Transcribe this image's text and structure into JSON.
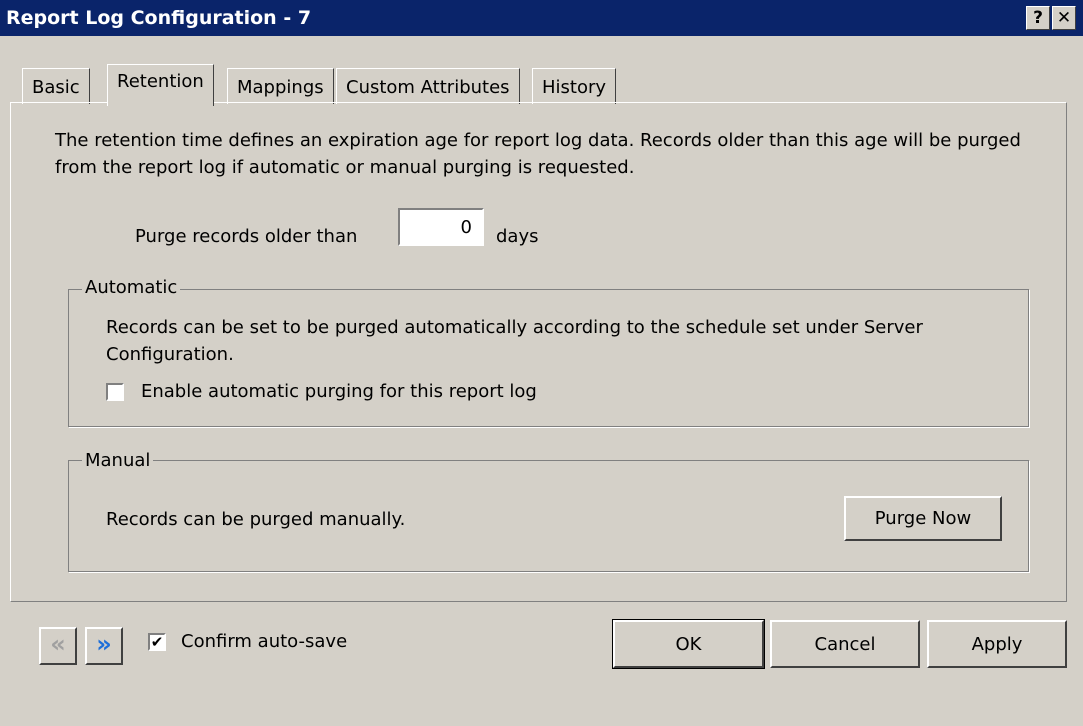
{
  "window": {
    "title": "Report Log Configuration - 7"
  },
  "titlebar": {
    "help_glyph": "?",
    "close_glyph": "✕"
  },
  "tabs": [
    {
      "label": "Basic"
    },
    {
      "label": "Retention"
    },
    {
      "label": "Mappings"
    },
    {
      "label": "Custom Attributes"
    },
    {
      "label": "History"
    }
  ],
  "retention": {
    "description": "The retention time defines an expiration age for report log data. Records older than this age will be purged from the report log if automatic or manual purging is requested.",
    "purge_label": "Purge records older than",
    "purge_days_value": "0",
    "days_unit": "days"
  },
  "automatic": {
    "group_label": "Automatic",
    "description": "Records can be set to be purged automatically according to the schedule set under Server Configuration.",
    "checkbox_label": "Enable automatic purging for this report log",
    "checked": false
  },
  "manual": {
    "group_label": "Manual",
    "description": "Records can be purged manually.",
    "purge_button": "Purge Now"
  },
  "footer": {
    "prev_glyph": "«",
    "next_glyph": "»",
    "confirm_autosave_label": "Confirm auto-save",
    "confirm_autosave_checked": true,
    "check_glyph": "✔",
    "ok": "OK",
    "cancel": "Cancel",
    "apply": "Apply"
  },
  "colors": {
    "titlebar": "#0a246a",
    "face": "#d4d0c8",
    "nav_active": "#1e6fd9",
    "nav_disabled": "#a0a0a0"
  }
}
